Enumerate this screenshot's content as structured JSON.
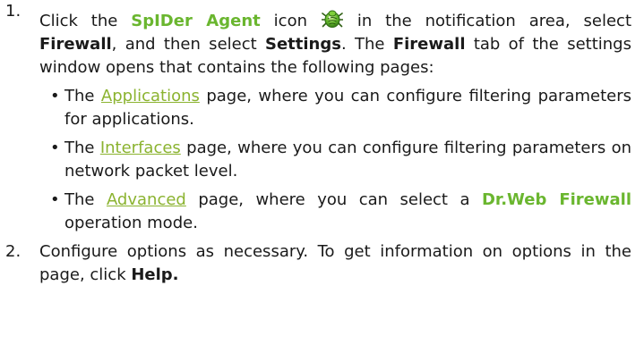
{
  "colors": {
    "accent_green": "#6ab62f",
    "link": "#8bb330",
    "text": "#1a1a1a"
  },
  "step1": {
    "number": "1.",
    "t1": "Click the ",
    "agent": "SpIDer Agent",
    "t2": " icon ",
    "icon": "spider-agent-icon",
    "t3": " in the notification area, select ",
    "firewall": "Firewall",
    "t4": ", and then select ",
    "settings": "Settings",
    "t5": ". The ",
    "firewall_tab": "Firewall",
    "t6": " tab of the settings window opens that contains the following pages:"
  },
  "pages": [
    {
      "pre": "The ",
      "link": "Applications",
      "post": " page, where you can configure filtering parameters for applications."
    },
    {
      "pre": "The ",
      "link": "Interfaces",
      "post": " page, where you can configure filtering parameters on network packet level."
    },
    {
      "pre": "The ",
      "link": "Advanced",
      "post": " page, where you can select a ",
      "bold": "Dr.Web Firewall",
      "post2": " operation mode."
    }
  ],
  "bullet": "•",
  "step2": {
    "number": "2.",
    "t1": "Configure options as necessary. To get information on options in the page, click ",
    "help": "Help."
  }
}
